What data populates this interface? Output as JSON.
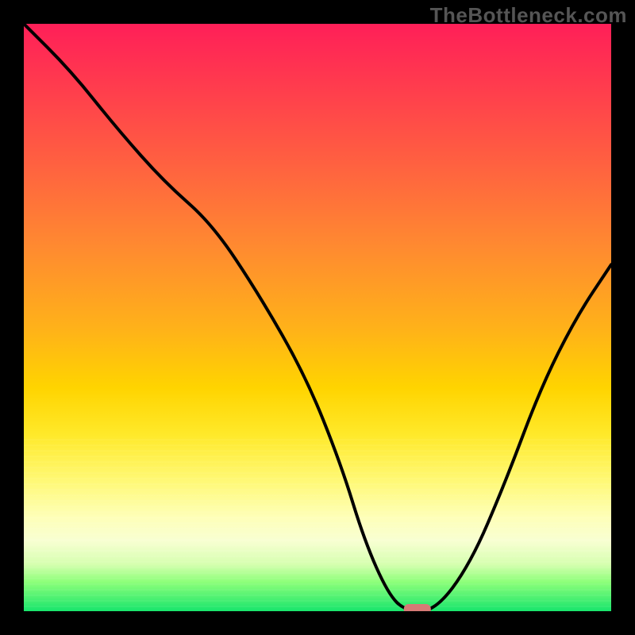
{
  "watermark": "TheBottleneck.com",
  "chart_data": {
    "type": "line",
    "title": "",
    "xlabel": "",
    "ylabel": "",
    "xlim": [
      0,
      100
    ],
    "ylim": [
      0,
      100
    ],
    "grid": false,
    "legend": false,
    "background": {
      "kind": "vertical-gradient",
      "stops": [
        {
          "pos": 0,
          "color": "#ff1f58"
        },
        {
          "pos": 25,
          "color": "#ff643f"
        },
        {
          "pos": 52,
          "color": "#ffb219"
        },
        {
          "pos": 78,
          "color": "#fff978"
        },
        {
          "pos": 100,
          "color": "#18e56c"
        }
      ]
    },
    "series": [
      {
        "name": "bottleneck-curve",
        "x": [
          0,
          8,
          16,
          24,
          32,
          40,
          48,
          54,
          58,
          62,
          65,
          70,
          76,
          82,
          88,
          94,
          100
        ],
        "y": [
          100,
          92,
          82,
          73,
          66,
          54,
          40,
          25,
          12,
          3,
          0,
          0,
          8,
          22,
          38,
          50,
          59
        ]
      }
    ],
    "marker": {
      "name": "optimal-point",
      "x": 67,
      "y": 0,
      "color": "#d67a76"
    }
  }
}
